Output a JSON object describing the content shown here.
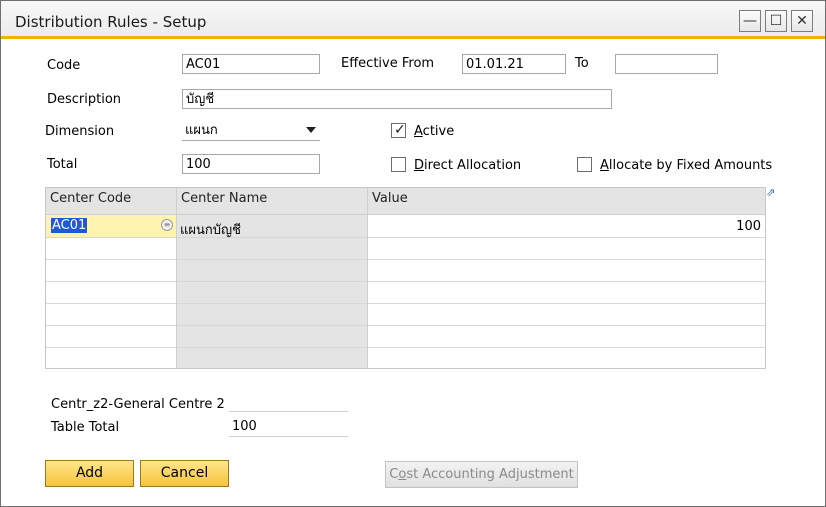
{
  "window": {
    "title": "Distribution Rules - Setup",
    "controls": {
      "minimize": "—",
      "maximize": "☐",
      "close": "✕"
    }
  },
  "form": {
    "code_label": "Code",
    "code_value": "AC01",
    "effective_from_label": "Effective From",
    "effective_from_value": "01.01.21",
    "to_label": "To",
    "to_value": "",
    "description_label": "Description",
    "description_value": "บัญชี",
    "dimension_label": "Dimension",
    "dimension_value": "แผนก",
    "total_label": "Total",
    "total_value": "100",
    "active_label_pre": "",
    "active_label_u": "A",
    "active_label_post": "ctive",
    "active_checked": true,
    "direct_alloc_u": "D",
    "direct_alloc_post": "irect Allocation",
    "direct_alloc_checked": false,
    "fixed_amounts_u": "A",
    "fixed_amounts_post": "llocate by Fixed Amounts",
    "fixed_amounts_checked": false
  },
  "grid": {
    "columns": [
      "Center Code",
      "Center Name",
      "Value"
    ],
    "rows": [
      {
        "center_code": "AC01",
        "center_name": "แผนกบัญชี",
        "value": "100"
      }
    ],
    "empty_rows": 6
  },
  "summary": {
    "centre_label": "Centr_z2-General Centre 2",
    "centre_value": "",
    "table_total_label": "Table Total",
    "table_total_value": "100"
  },
  "buttons": {
    "add": "Add",
    "cancel": "Cancel",
    "cost_adj_pre": "C",
    "cost_adj_u": "o",
    "cost_adj_post": "st Accounting Adjustment"
  },
  "colors": {
    "accent": "#f0b400",
    "button": "#f5c43c",
    "selection": "#1e5ad8",
    "active_cell": "#fff3b0"
  }
}
